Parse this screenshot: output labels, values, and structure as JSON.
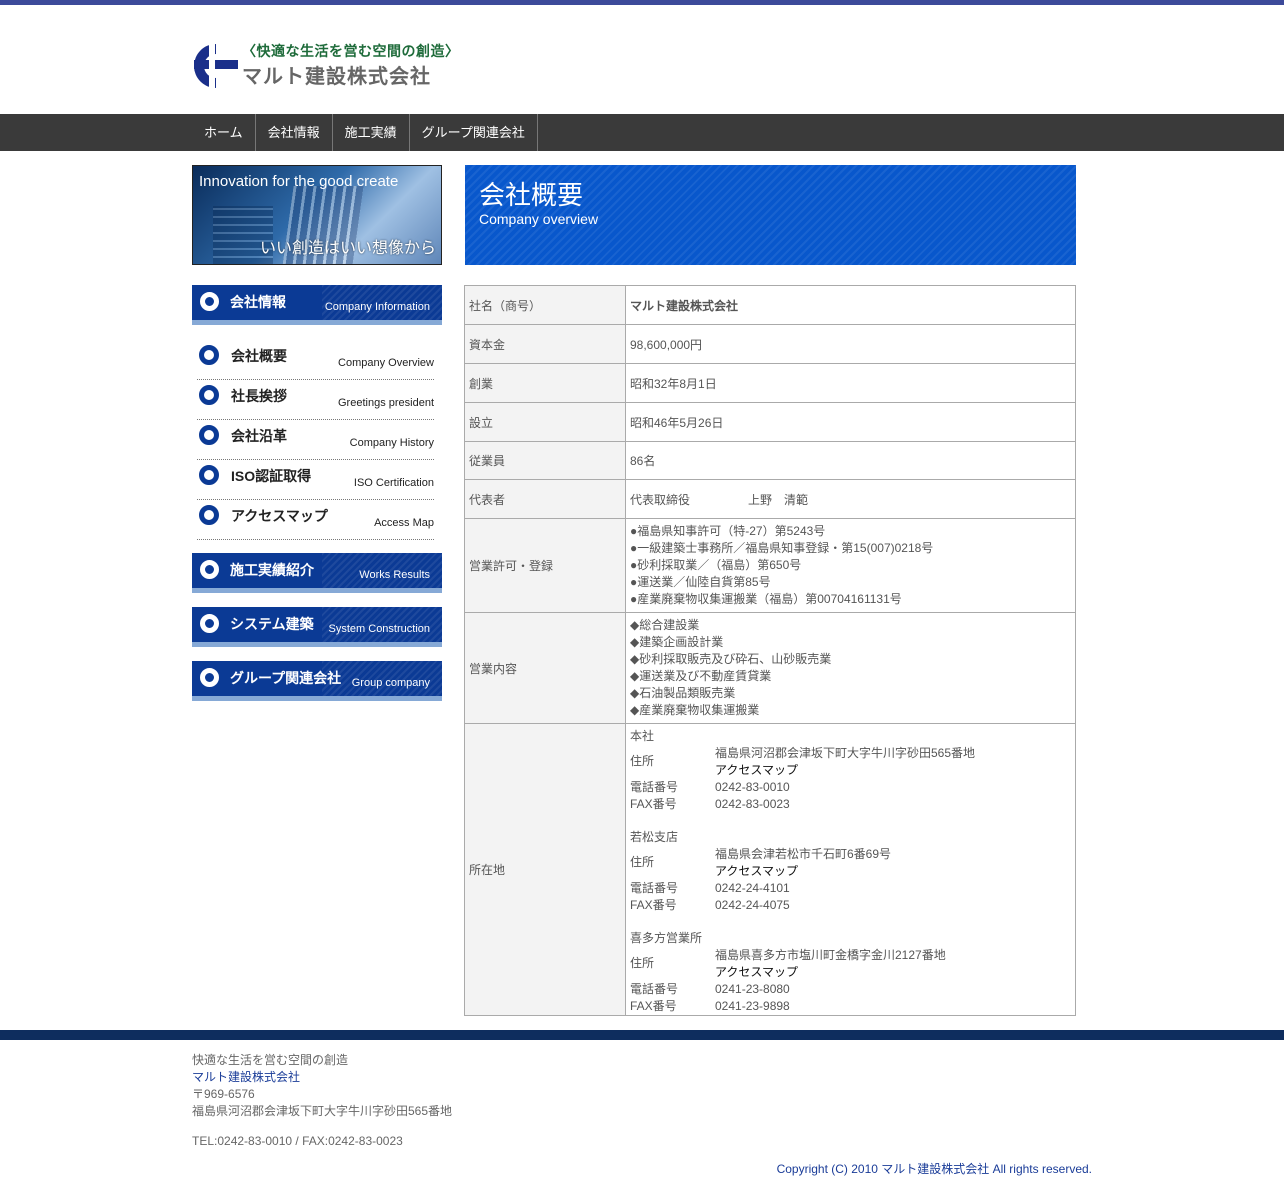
{
  "logo": {
    "tagline": "〈快適な生活を営む空間の創造〉",
    "company": "マルト建設株式会社"
  },
  "nav": [
    "ホーム",
    "会社情報",
    "施工実績",
    "グループ関連会社"
  ],
  "banner": {
    "top": "Innovation for the good create",
    "bottom": "いい創造はいい想像から"
  },
  "sidebar": {
    "company_info": {
      "jp": "会社情報",
      "en": "Company Information"
    },
    "items": [
      {
        "jp": "会社概要",
        "en": "Company Overview"
      },
      {
        "jp": "社長挨拶",
        "en": "Greetings president"
      },
      {
        "jp": "会社沿革",
        "en": "Company History"
      },
      {
        "jp": "ISO認証取得",
        "en": "ISO Certification"
      },
      {
        "jp": "アクセスマップ",
        "en": "Access Map"
      }
    ],
    "works": {
      "jp": "施工実績紹介",
      "en": "Works Results"
    },
    "system": {
      "jp": "システム建築",
      "en": "System Construction"
    },
    "group": {
      "jp": "グループ関連会社",
      "en": "Group company"
    }
  },
  "header": {
    "title": "会社概要",
    "subtitle": "Company overview"
  },
  "table": {
    "name": {
      "label": "社名（商号）",
      "value": "マルト建設株式会社"
    },
    "capital": {
      "label": "資本金",
      "value": "98,600,000円"
    },
    "founded": {
      "label": "創業",
      "value": "昭和32年8月1日"
    },
    "established": {
      "label": "設立",
      "value": "昭和46年5月26日"
    },
    "employees": {
      "label": "従業員",
      "value": "86名"
    },
    "representative": {
      "label": "代表者",
      "title": "代表取締役",
      "name": "上野　清範"
    },
    "licenses": {
      "label": "営業許可・登録",
      "lines": [
        "●福島県知事許可（特-27）第5243号",
        "●一級建築士事務所／福島県知事登録・第15(007)0218号",
        "●砂利採取業／（福島）第650号",
        "●運送業／仙陸自貨第85号",
        "●産業廃棄物収集運搬業（福島）第00704161131号"
      ]
    },
    "business": {
      "label": "営業内容",
      "lines": [
        "◆総合建設業",
        "◆建築企画設計業",
        "◆砂利採取販売及び砕石、山砂販売業",
        "◆運送業及び不動産賃貸業",
        "◆石油製品類販売業",
        "◆産業廃棄物収集運搬業"
      ]
    },
    "location": {
      "label": "所在地",
      "addr_label": "住所",
      "tel_label": "電話番号",
      "fax_label": "FAX番号",
      "access_label": "アクセスマップ",
      "offices": [
        {
          "name": "本社",
          "address": "福島県河沼郡会津坂下町大字牛川字砂田565番地",
          "tel": "0242-83-0010",
          "fax": "0242-83-0023"
        },
        {
          "name": "若松支店",
          "address": "福島県会津若松市千石町6番69号",
          "tel": "0242-24-4101",
          "fax": "0242-24-4075"
        },
        {
          "name": "喜多方営業所",
          "address": "福島県喜多方市塩川町金橋字金川2127番地",
          "tel": "0241-23-8080",
          "fax": "0241-23-9898"
        }
      ]
    }
  },
  "footer": {
    "tagline": "快適な生活を営む空間の創造",
    "company": "マルト建設株式会社",
    "postal": "〒969-6576",
    "address": "福島県河沼郡会津坂下町大字牛川字砂田565番地",
    "tel": "TEL:0242-83-0010 / FAX:0242-83-0023",
    "copyright": "Copyright (C) 2010 マルト建設株式会社 All rights reserved."
  },
  "colors": {
    "topbar": "#3c4a9a",
    "nav": "#3a3a3a",
    "accent": "#0857cc",
    "sidebar_block": "#0b3a95",
    "footer_band": "#0e2d5e",
    "link": "#1a3c98"
  }
}
